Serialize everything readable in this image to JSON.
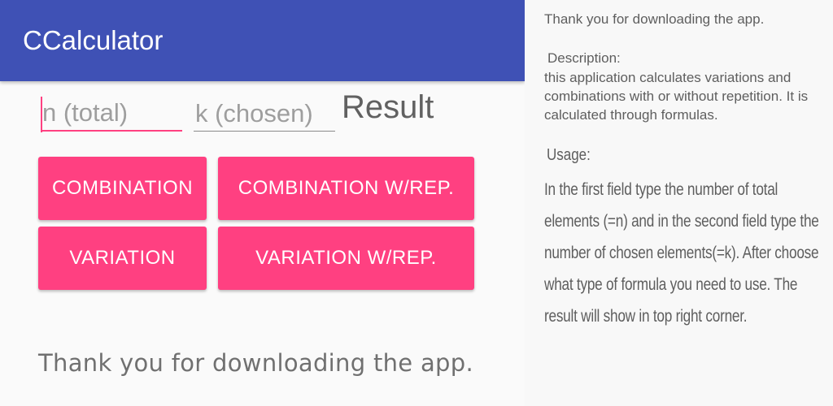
{
  "app": {
    "title": "CCalculator"
  },
  "inputs": {
    "n_placeholder": "n (total)",
    "k_placeholder": "k (chosen)",
    "n_value": "",
    "k_value": ""
  },
  "result": {
    "label": "Result"
  },
  "buttons": {
    "combination": "COMBINATION",
    "combination_rep": "COMBINATION W/REP.",
    "variation": "VARIATION",
    "variation_rep": "VARIATION W/REP."
  },
  "footer": {
    "thanks": "Thank you for downloading the app."
  },
  "info_panel": {
    "thanks": "Thank you for downloading the app.",
    "description_heading": "Description:",
    "description": "this application calculates variations and combinations with or without repetition. It is calculated through formulas.",
    "usage_heading": "Usage:",
    "usage": "In the first field type the number of total elements (=n) and in the second field type the number of chosen elements(=k). After choose what type of formula you need to use. The result will show in top right corner."
  },
  "colors": {
    "primary": "#3f51b5",
    "accent": "#ff4081",
    "background": "#fafafa"
  }
}
